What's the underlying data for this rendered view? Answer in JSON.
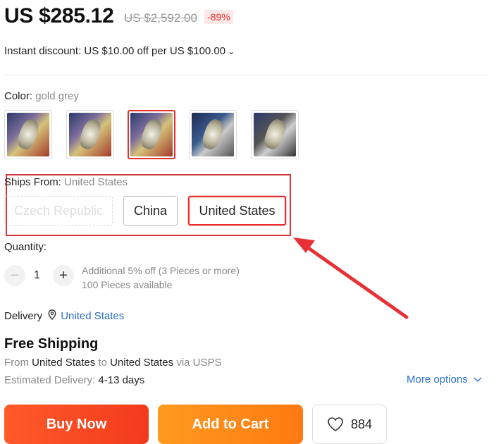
{
  "price": {
    "current": "US $285.12",
    "original": "US $2,592.00",
    "discount": "-89%"
  },
  "instant_discount": {
    "text": "Instant discount: US $10.00 off per US $100.00",
    "chevron_icon": "chevron-down-icon"
  },
  "color": {
    "label": "Color:",
    "value": "gold grey",
    "swatches": [
      "watch-gold",
      "watch-silver",
      "watch-gold-grey",
      "watch-blue",
      "watch-black"
    ],
    "selected_index": 2
  },
  "ships_from": {
    "label": "Ships From:",
    "value": "United States",
    "options": [
      "Czech Republic",
      "China",
      "United States"
    ]
  },
  "quantity": {
    "label": "Quantity:",
    "minus": "−",
    "value": "1",
    "plus": "+",
    "promo": "Additional 5% off (3 Pieces or more)",
    "available": "100 Pieces available"
  },
  "delivery": {
    "label": "Delivery",
    "location": "United States",
    "pin_icon": "location-pin-icon"
  },
  "shipping": {
    "title": "Free Shipping",
    "from_prefix": "From",
    "from_country": "United States",
    "to_word": "to",
    "to_country": "United States",
    "via": "via USPS",
    "est_label": "Estimated Delivery:",
    "est_value": "4-13 days",
    "more_options": "More options"
  },
  "actions": {
    "buy_now": "Buy Now",
    "add_to_cart": "Add to Cart",
    "wishlist_count": "884"
  },
  "colors": {
    "accent_red": "#e62e2e",
    "annotation_red": "#d0383d",
    "link_blue": "#2c6ecb",
    "buy_gradient": "#ff5a2a",
    "cart_gradient": "#ff9a1f"
  }
}
